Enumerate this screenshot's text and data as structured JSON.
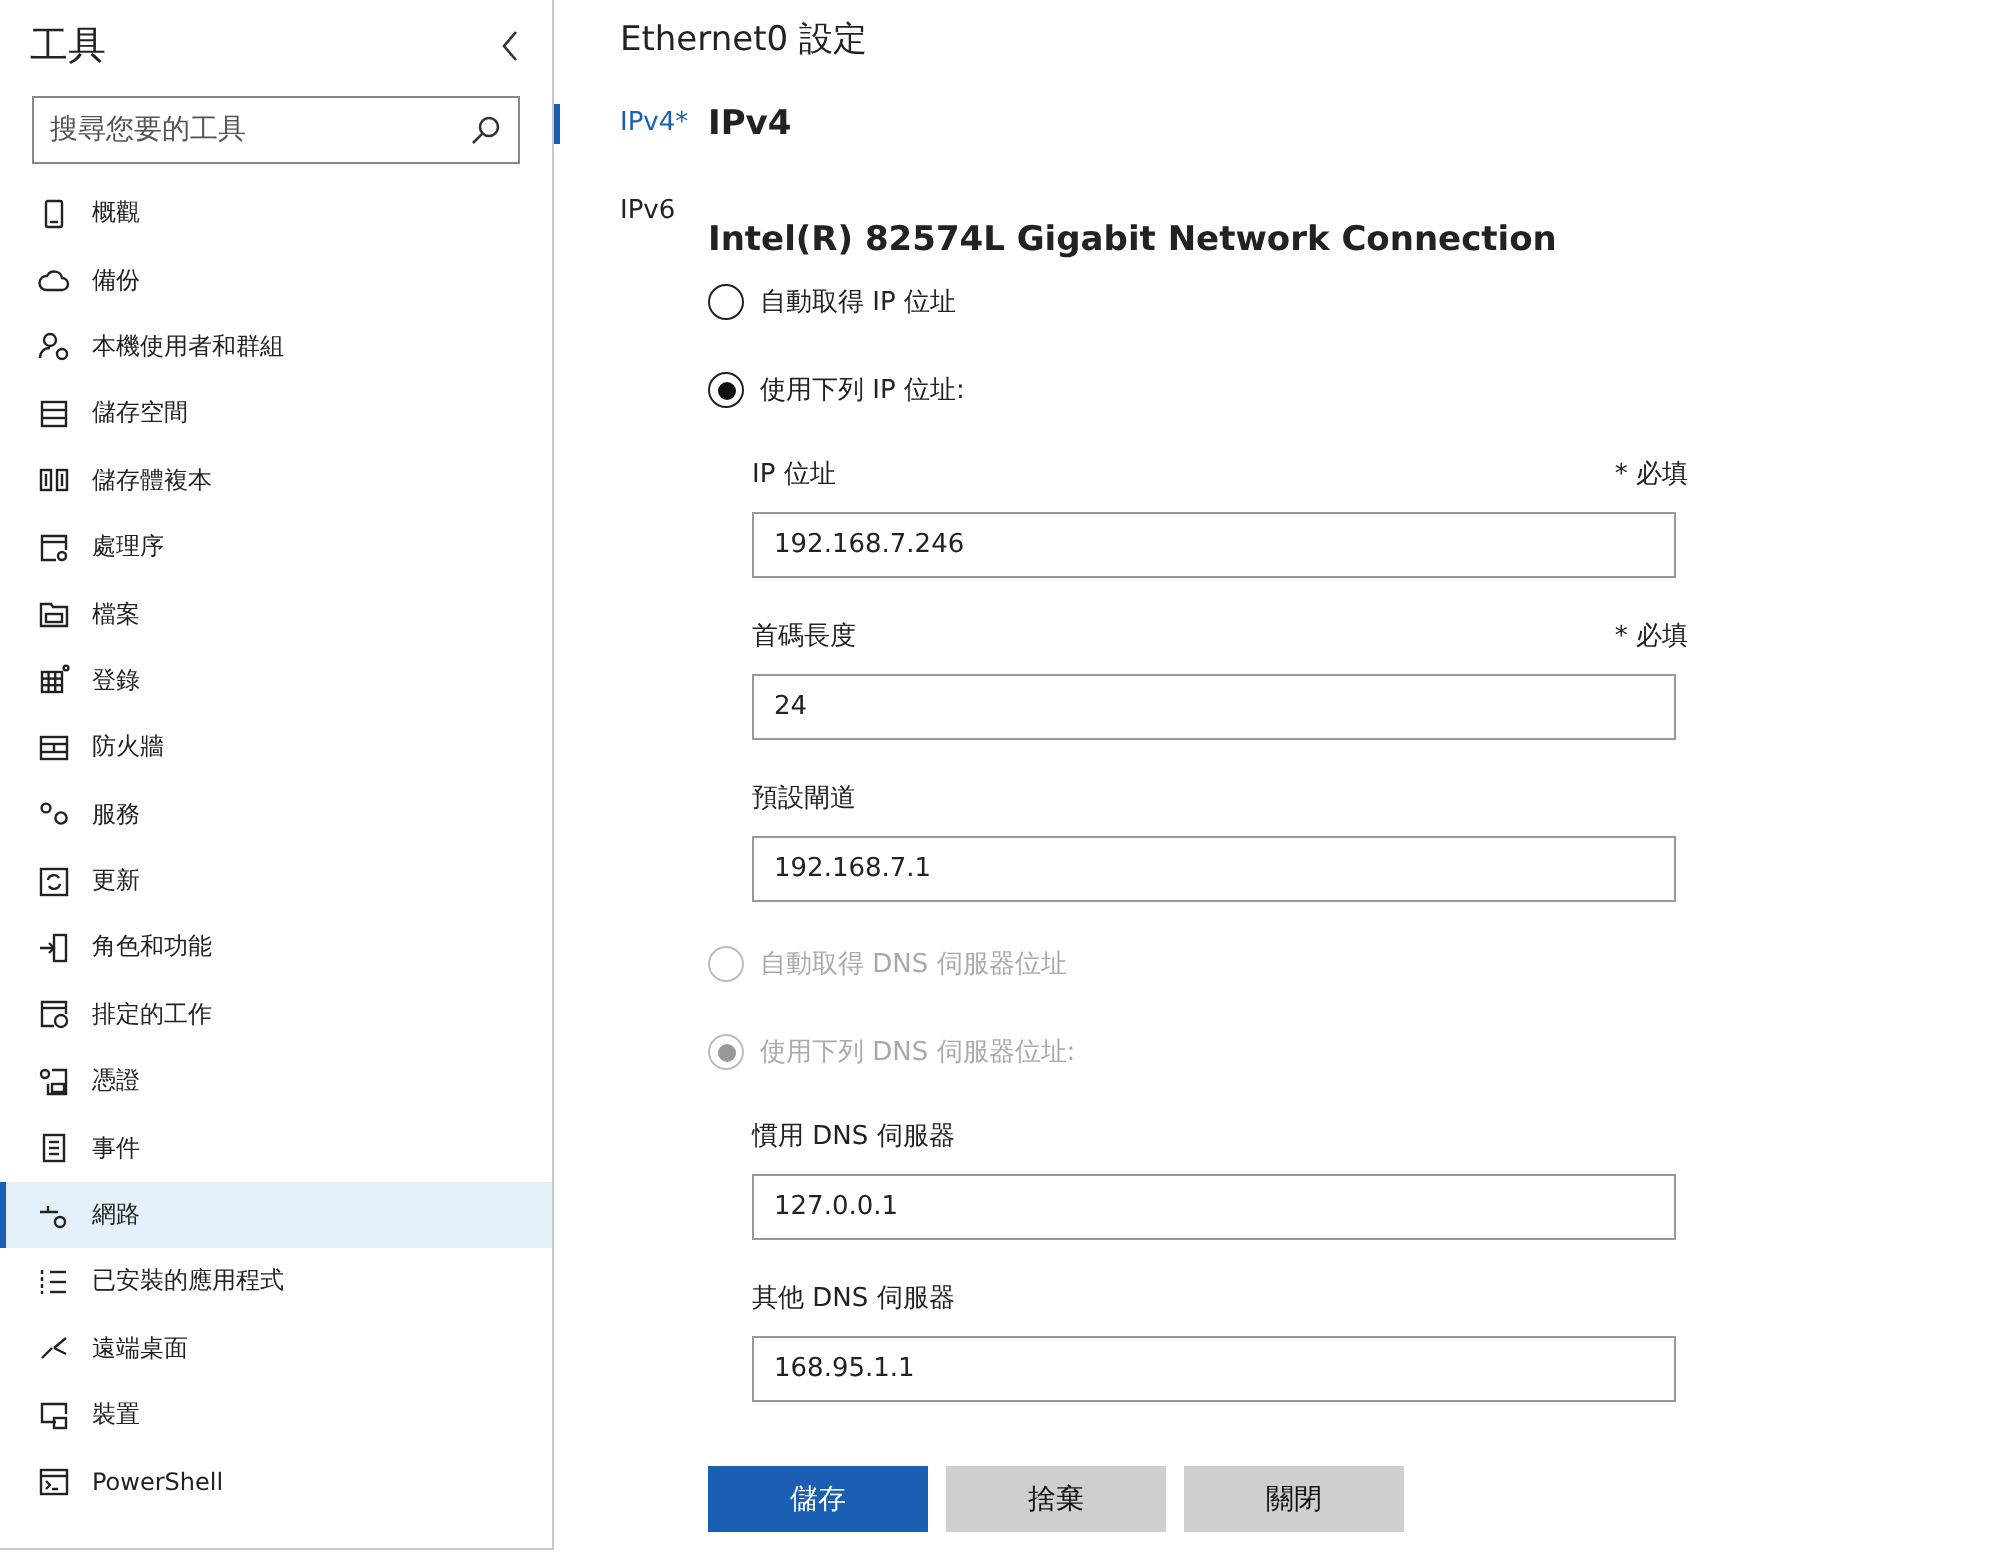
{
  "sidebar": {
    "title": "工具",
    "search": {
      "placeholder": "搜尋您要的工具"
    },
    "items": [
      {
        "label": "概觀",
        "selected": false
      },
      {
        "label": "備份",
        "selected": false
      },
      {
        "label": "本機使用者和群組",
        "selected": false
      },
      {
        "label": "儲存空間",
        "selected": false
      },
      {
        "label": "儲存體複本",
        "selected": false
      },
      {
        "label": "處理序",
        "selected": false
      },
      {
        "label": "檔案",
        "selected": false
      },
      {
        "label": "登錄",
        "selected": false
      },
      {
        "label": "防火牆",
        "selected": false
      },
      {
        "label": "服務",
        "selected": false
      },
      {
        "label": "更新",
        "selected": false
      },
      {
        "label": "角色和功能",
        "selected": false
      },
      {
        "label": "排定的工作",
        "selected": false
      },
      {
        "label": "憑證",
        "selected": false
      },
      {
        "label": "事件",
        "selected": false
      },
      {
        "label": "網路",
        "selected": true
      },
      {
        "label": "已安裝的應用程式",
        "selected": false
      },
      {
        "label": "遠端桌面",
        "selected": false
      },
      {
        "label": "裝置",
        "selected": false
      },
      {
        "label": "PowerShell",
        "selected": false
      }
    ]
  },
  "panel": {
    "title": "Ethernet0 設定",
    "tabs": [
      {
        "label": "IPv4*",
        "selected": true
      },
      {
        "label": "IPv6",
        "selected": false
      }
    ],
    "heading": "IPv4",
    "adapter": "Intel(R) 82574L Gigabit Network Connection",
    "ip_options": [
      {
        "label": "自動取得 IP 位址",
        "selected": false,
        "disabled": false
      },
      {
        "label": "使用下列 IP 位址:",
        "selected": true,
        "disabled": false
      }
    ],
    "ip_fields": [
      {
        "label": "IP 位址",
        "required": "* 必填",
        "value": "192.168.7.246"
      },
      {
        "label": "首碼長度",
        "required": "* 必填",
        "value": "24"
      },
      {
        "label": "預設閘道",
        "value": "192.168.7.1"
      }
    ],
    "dns_options": [
      {
        "label": "自動取得 DNS 伺服器位址",
        "selected": false,
        "disabled": true
      },
      {
        "label": "使用下列 DNS 伺服器位址:",
        "selected": true,
        "disabled": true
      }
    ],
    "dns_fields": [
      {
        "label": "慣用 DNS 伺服器",
        "value": "127.0.0.1"
      },
      {
        "label": "其他 DNS 伺服器",
        "value": "168.95.1.1"
      }
    ],
    "buttons": [
      {
        "label": "儲存",
        "kind": "primary"
      },
      {
        "label": "捨棄",
        "kind": "secondary"
      },
      {
        "label": "關閉",
        "kind": "secondary"
      }
    ]
  }
}
